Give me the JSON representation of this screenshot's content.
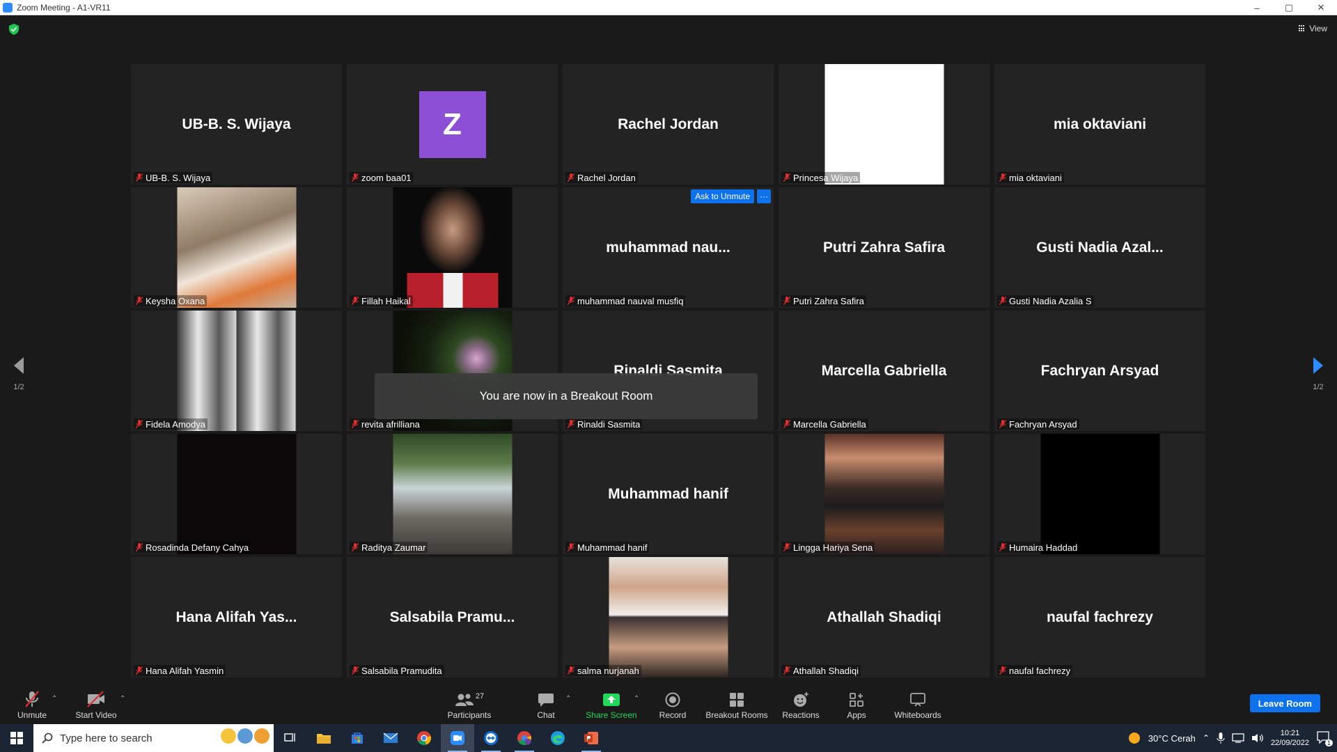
{
  "window": {
    "title": "Zoom Meeting - A1-VR11",
    "minimize": "–",
    "maximize": "▢",
    "close": "✕"
  },
  "view_label": "View",
  "pagination": {
    "left": "1/2",
    "right": "1/2"
  },
  "toast": "You are now in a Breakout Room",
  "ask_to_unmute": "Ask to Unmute",
  "more_dots": "···",
  "tiles": [
    {
      "display": "UB-B. S. Wijaya",
      "label": "UB-B. S. Wijaya"
    },
    {
      "display": "Z",
      "label": "zoom baa01",
      "avatar_color": "#8c4fd6"
    },
    {
      "display": "Rachel Jordan",
      "label": "Rachel Jordan"
    },
    {
      "display": "",
      "label": "Princesa Wijaya"
    },
    {
      "display": "mia oktaviani",
      "label": "mia oktaviani"
    },
    {
      "display": "",
      "label": "Keysha Oxana"
    },
    {
      "display": "",
      "label": "Fillah Haikal"
    },
    {
      "display": "muhammad  nau...",
      "label": "muhammad nauval musfiq"
    },
    {
      "display": "Putri Zahra Safira",
      "label": "Putri Zahra Safira"
    },
    {
      "display": "Gusti  Nadia  Azal...",
      "label": "Gusti Nadia Azalia S"
    },
    {
      "display": "",
      "label": "Fidela Amodya"
    },
    {
      "display": "",
      "label": "revita afrilliana"
    },
    {
      "display": "Rinaldi Sasmita",
      "label": "Rinaldi Sasmita"
    },
    {
      "display": "Marcella Gabriella",
      "label": "Marcella Gabriella"
    },
    {
      "display": "Fachryan Arsyad",
      "label": "Fachryan Arsyad"
    },
    {
      "display": "",
      "label": "Rosadinda Defany Cahya"
    },
    {
      "display": "",
      "label": "Raditya Zaumar"
    },
    {
      "display": "Muhammad hanif",
      "label": "Muhammad hanif"
    },
    {
      "display": "",
      "label": "Lingga Hariya Sena"
    },
    {
      "display": "",
      "label": "Humaira Haddad"
    },
    {
      "display": "Hana  Alifah  Yas...",
      "label": "Hana Alifah Yasmin"
    },
    {
      "display": "Salsabila  Pramu...",
      "label": "Salsabila Pramudita"
    },
    {
      "display": "",
      "label": "salma nurjanah"
    },
    {
      "display": "Athallah Shadiqi",
      "label": "Athallah Shadiqi"
    },
    {
      "display": "naufal fachrezy",
      "label": "naufal fachrezy"
    }
  ],
  "toolbar": {
    "unmute": "Unmute",
    "start_video": "Start Video",
    "participants": "Participants",
    "participants_count": "27",
    "chat": "Chat",
    "share_screen": "Share Screen",
    "record": "Record",
    "breakout_rooms": "Breakout Rooms",
    "reactions": "Reactions",
    "apps": "Apps",
    "whiteboards": "Whiteboards",
    "leave_room": "Leave Room"
  },
  "taskbar": {
    "search_placeholder": "Type here to search",
    "weather": "30°C  Cerah",
    "time": "10:21",
    "date": "22/09/2022",
    "notification_count": "1"
  },
  "colors": {
    "accent": "#0e72ed",
    "share_green": "#23d959",
    "mute_red": "#e02f2f"
  }
}
